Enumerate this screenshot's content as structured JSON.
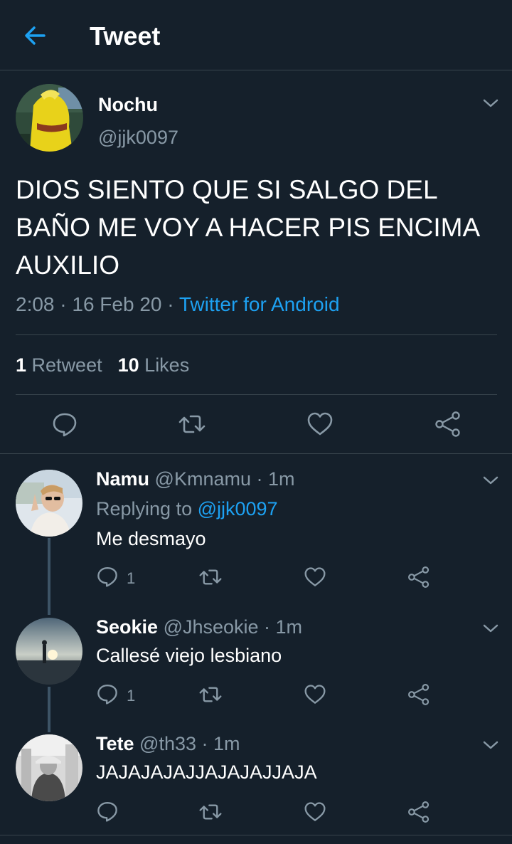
{
  "header": {
    "title": "Tweet"
  },
  "tweet": {
    "name": "Nochu",
    "handle": "@jjk0097",
    "text": "DIOS SIENTO QUE SI SALGO DEL BAÑO ME VOY A HACER PIS ENCIMA AUXILIO",
    "time": "2:08 · 16 Feb 20 · ",
    "source": "Twitter for Android",
    "retweets": "1",
    "retweets_label": "Retweet",
    "likes": "10",
    "likes_label": "Likes"
  },
  "replies": [
    {
      "name": "Namu",
      "handle": "@Kmnamu · 1m",
      "replying_prefix": "Replying to ",
      "replying_to": "@jjk0097",
      "text": "Me desmayo",
      "reply_count": "1"
    },
    {
      "name": "Seokie",
      "handle": "@Jhseokie · 1m",
      "text": "Callesé viejo lesbiano",
      "reply_count": "1"
    },
    {
      "name": "Tete",
      "handle": "@th33 · 1m",
      "text": "JAJAJAJAJJAJAJAJJAJA"
    }
  ],
  "colors": {
    "background": "#15202b",
    "accent": "#1da1f2",
    "secondary_text": "#8899a6",
    "divider": "#38444d"
  }
}
